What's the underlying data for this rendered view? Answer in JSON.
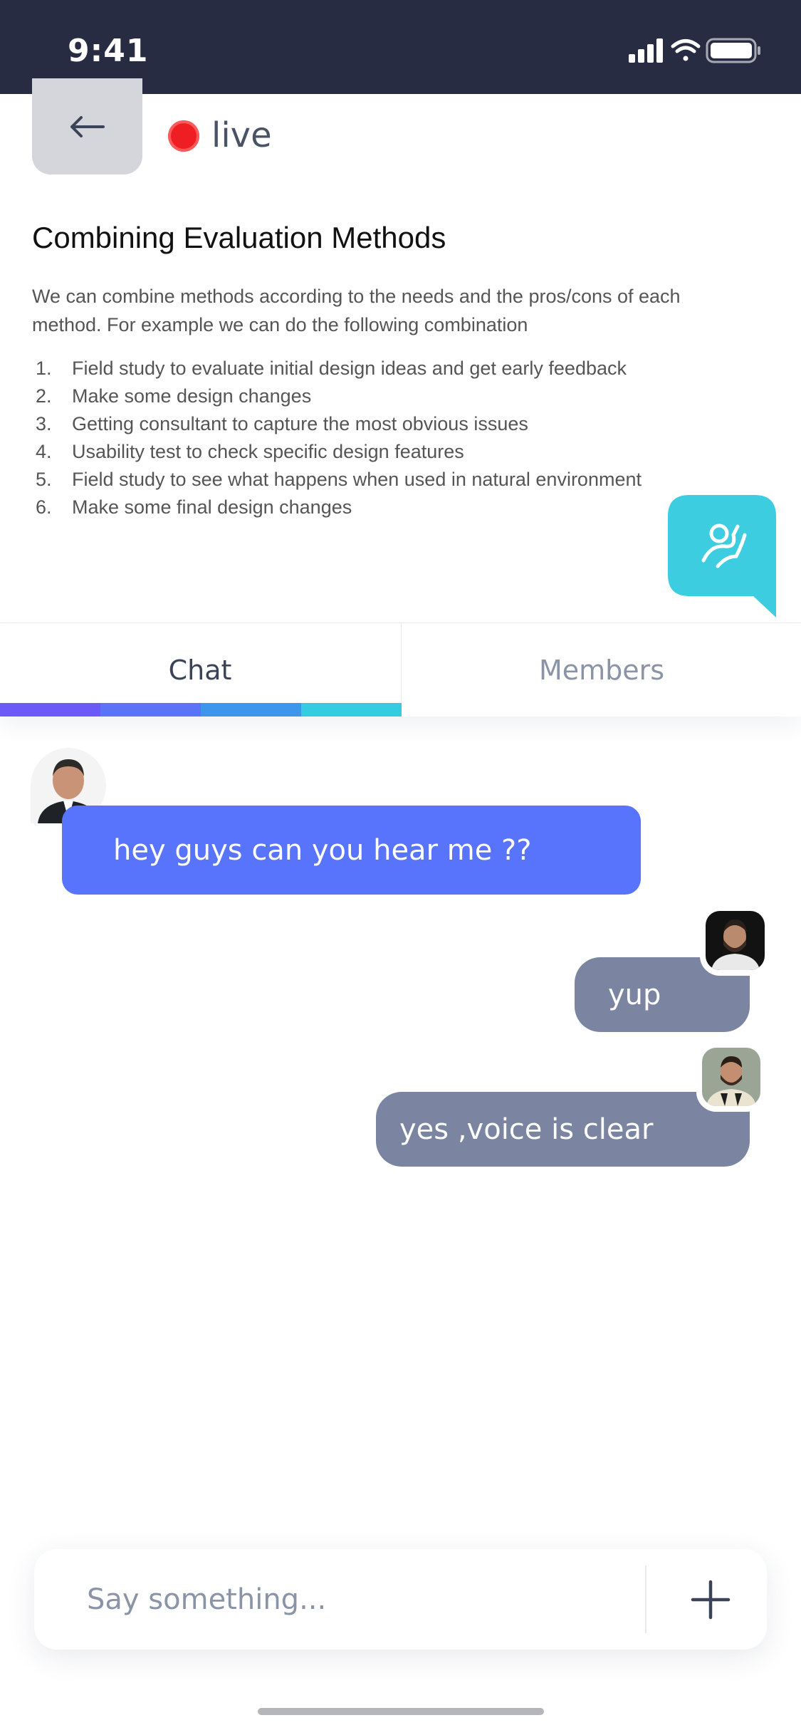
{
  "status_bar": {
    "time": "9:41",
    "icons": [
      "signal-icon",
      "wifi-icon",
      "battery-icon"
    ]
  },
  "header": {
    "back_icon": "arrow-left-icon",
    "live_label": "live",
    "live_color": "#ee1e23"
  },
  "slide": {
    "title": "Combining Evaluation Methods",
    "intro": "We can combine methods according to the needs and the pros/cons of each method. For example we can do the following combination",
    "items": [
      {
        "num": "1.",
        "text": "Field study to evaluate initial design ideas and get early feedback"
      },
      {
        "num": "2.",
        "text": "Make some design changes"
      },
      {
        "num": "3.",
        "text": "Getting consultant to capture the most obvious issues"
      },
      {
        "num": "4.",
        "text": "Usability test to check specific design features"
      },
      {
        "num": "5.",
        "text": "Field study to see what happens when used in natural environment"
      },
      {
        "num": "6.",
        "text": "Make some final design changes"
      }
    ]
  },
  "fab": {
    "icon": "raise-hand-icon",
    "color": "#3ccde0"
  },
  "tabs": [
    {
      "label": "Chat",
      "active": true
    },
    {
      "label": "Members",
      "active": false
    }
  ],
  "tab_indicator_colors": [
    "#6c5af8",
    "#5b73f6",
    "#3d96ea",
    "#35cce2"
  ],
  "messages": [
    {
      "text": "hey guys can you hear me ??",
      "color": "#5873fc"
    },
    {
      "text": "yup",
      "color": "#7b85a1"
    },
    {
      "text": "yes ,voice is clear",
      "color": "#7b85a1"
    }
  ],
  "composer": {
    "placeholder": "Say something...",
    "add_icon": "plus-icon"
  }
}
